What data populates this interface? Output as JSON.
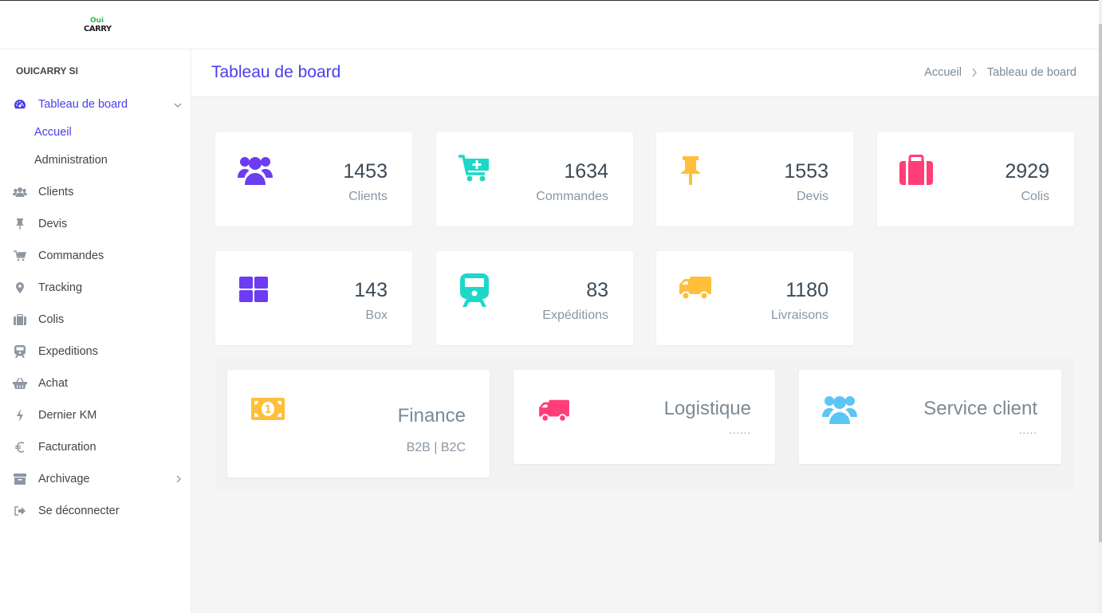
{
  "app": {
    "logo_top": "Oui",
    "logo_bottom": "CARRY",
    "brand": "OUICARRY SI"
  },
  "colors": {
    "accent": "#4a3ee8",
    "purple": "#6c3cf0",
    "cyan": "#1dd8c8",
    "amber": "#ffbf3a",
    "pink": "#ff3d77",
    "skyblue": "#5bc6f5"
  },
  "sidebar": {
    "dashboard": {
      "label": "Tableau de board",
      "icon": "tachometer-icon"
    },
    "subitems": [
      {
        "label": "Accueil"
      },
      {
        "label": "Administration"
      }
    ],
    "items": [
      {
        "label": "Clients",
        "icon": "users-icon"
      },
      {
        "label": "Devis",
        "icon": "thumbtack-icon"
      },
      {
        "label": "Commandes",
        "icon": "cart-plus-icon"
      },
      {
        "label": "Tracking",
        "icon": "map-marker-icon"
      },
      {
        "label": "Colis",
        "icon": "suitcase-icon"
      },
      {
        "label": "Expeditions",
        "icon": "train-icon"
      },
      {
        "label": "Achat",
        "icon": "basket-icon"
      },
      {
        "label": "Dernier KM",
        "icon": "bolt-icon"
      },
      {
        "label": "Facturation",
        "icon": "euro-icon"
      },
      {
        "label": "Archivage",
        "icon": "archive-icon"
      },
      {
        "label": "Se déconnecter",
        "icon": "sign-out-icon"
      }
    ]
  },
  "header": {
    "title": "Tableau de board",
    "breadcrumb": [
      "Accueil",
      "Tableau de board"
    ]
  },
  "stats": [
    {
      "value": "1453",
      "label": "Clients",
      "icon": "users-icon"
    },
    {
      "value": "1634",
      "label": "Commandes",
      "icon": "cart-plus-icon"
    },
    {
      "value": "1553",
      "label": "Devis",
      "icon": "thumbtack-icon"
    },
    {
      "value": "2929",
      "label": "Colis",
      "icon": "suitcase-icon"
    },
    {
      "value": "143",
      "label": "Box",
      "icon": "th-large-icon"
    },
    {
      "value": "83",
      "label": "Expéditions",
      "icon": "train-icon"
    },
    {
      "value": "1180",
      "label": "Livraisons",
      "icon": "truck-icon"
    }
  ],
  "panels": [
    {
      "title": "Finance",
      "subtitle": "B2B | B2C",
      "icon": "money-bill-icon"
    },
    {
      "title": "Logistique",
      "subtitle": "......",
      "icon": "truck-icon"
    },
    {
      "title": "Service client",
      "subtitle": ".....",
      "icon": "users-icon"
    }
  ]
}
